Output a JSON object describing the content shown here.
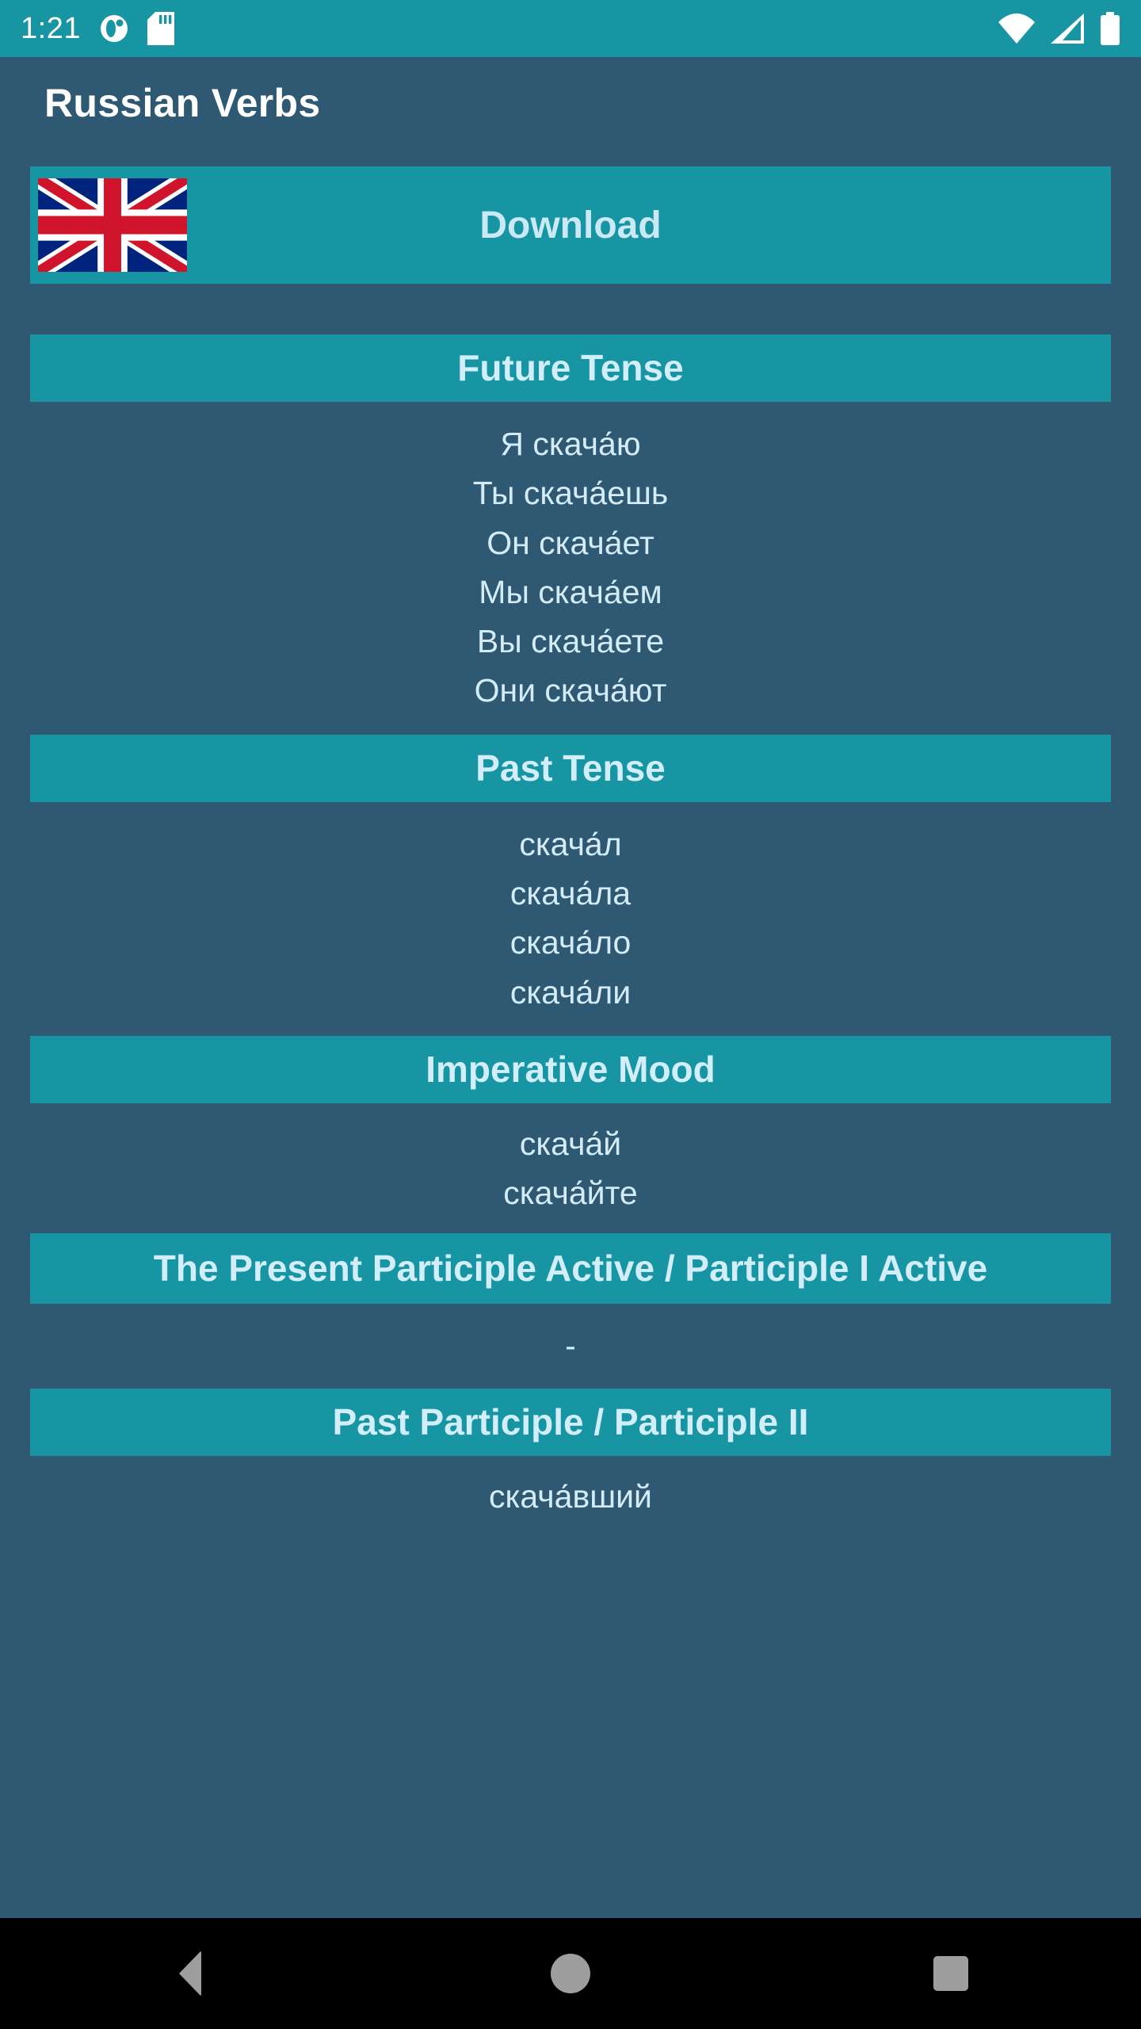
{
  "status_bar": {
    "clock": "1:21",
    "background_color": "#1795a3",
    "notification_icons": [
      "clock-alarm-icon",
      "sd-card-icon"
    ],
    "system_icons": [
      "wifi-icon",
      "cellular-signal-icon",
      "battery-icon"
    ]
  },
  "app_bar": {
    "title": "Russian Verbs",
    "background_color": "#2f5872",
    "title_color": "#ffffff"
  },
  "theme": {
    "background": "#2f5872",
    "accent": "#1795a3",
    "text_light": "#d3ecf7",
    "header_text": "#d2eefb"
  },
  "download": {
    "label": "Download",
    "flag_icon": "uk-flag-icon"
  },
  "sections": [
    {
      "id": "future-tense",
      "title": "Future Tense",
      "lines": [
        "Я скача́ю",
        "Ты скача́ешь",
        "Он скача́ет",
        "Мы скача́ем",
        "Вы скача́ете",
        "Они скача́ют"
      ]
    },
    {
      "id": "past-tense",
      "title": "Past Tense",
      "lines": [
        "скача́л",
        "скача́ла",
        "скача́ло",
        "скача́ли"
      ]
    },
    {
      "id": "imperative-mood",
      "title": "Imperative Mood",
      "lines": [
        "скача́й",
        "скача́йте"
      ]
    },
    {
      "id": "present-participle-active",
      "title": "The Present Participle Active / Participle I Active",
      "lines": [
        "-"
      ]
    },
    {
      "id": "past-participle",
      "title": "Past Participle / Participle II",
      "lines": [
        "скача́вший"
      ]
    }
  ],
  "nav_bar": {
    "buttons": [
      "back-button",
      "home-button",
      "recents-button"
    ],
    "background_color": "#000000"
  }
}
